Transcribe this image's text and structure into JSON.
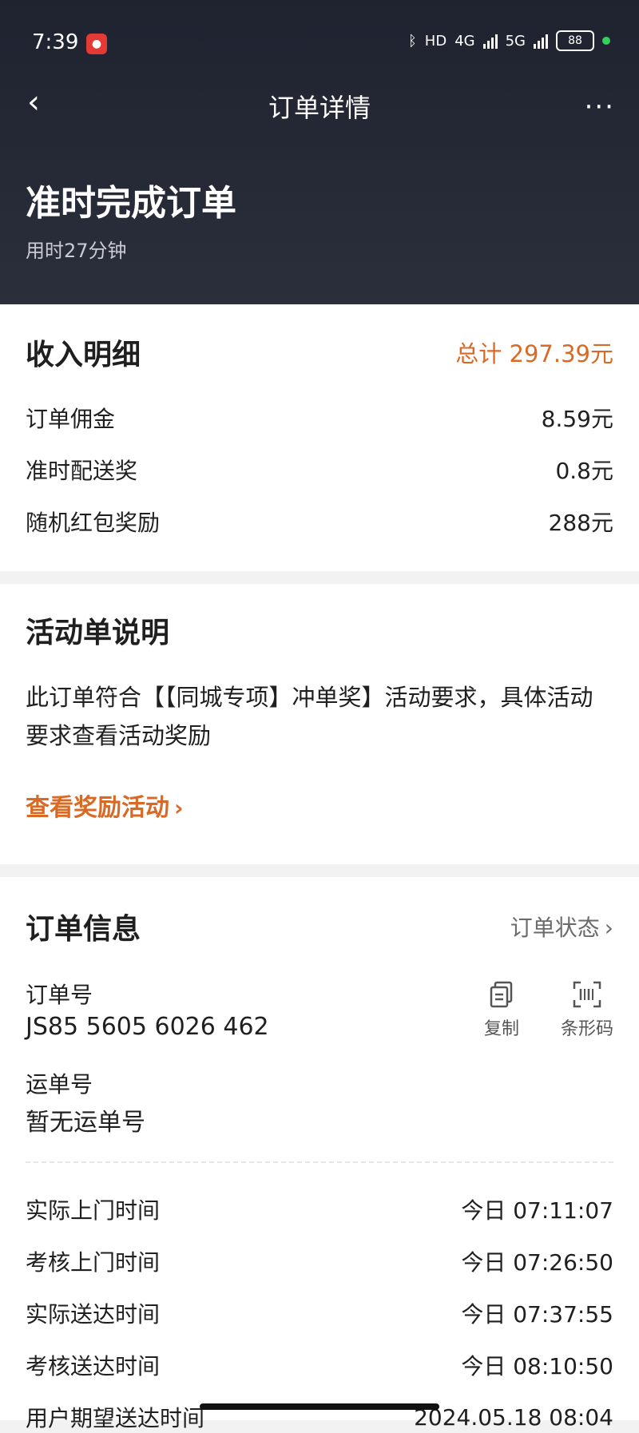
{
  "status_bar": {
    "time": "7:39",
    "hd_label": "HD",
    "net_4g": "4G",
    "net_5g": "5G",
    "battery": "88"
  },
  "nav": {
    "title": "订单详情",
    "back_glyph": "‹",
    "more_glyph": "···"
  },
  "order_header": {
    "title": "准时完成订单",
    "subtitle": "用时27分钟"
  },
  "income": {
    "title": "收入明细",
    "total": "总计 297.39元",
    "items": [
      {
        "label": "订单佣金",
        "value": "8.59元"
      },
      {
        "label": "准时配送奖",
        "value": "0.8元"
      },
      {
        "label": "随机红包奖励",
        "value": "288元"
      }
    ]
  },
  "activity": {
    "title": "活动单说明",
    "description": "此订单符合【【同城专项】冲单奖】活动要求，具体活动要求查看活动奖励",
    "link": "查看奖励活动"
  },
  "order_info": {
    "title": "订单信息",
    "status_link": "订单状态",
    "order_number_label": "订单号",
    "order_number": "JS85 5605 6026 462",
    "copy_label": "复制",
    "barcode_label": "条形码",
    "waybill_label": "运单号",
    "waybill_value": "暂无运单号",
    "times": [
      {
        "label": "实际上门时间",
        "value": "今日 07:11:07"
      },
      {
        "label": "考核上门时间",
        "value": "今日 07:26:50"
      },
      {
        "label": "实际送达时间",
        "value": "今日 07:37:55"
      },
      {
        "label": "考核送达时间",
        "value": "今日 08:10:50"
      },
      {
        "label": "用户期望送达时间",
        "value": "2024.05.18 08:04"
      }
    ]
  },
  "icons": {
    "back": "back-chevron-icon",
    "more": "more-dots-icon",
    "copy": "copy-icon",
    "barcode": "barcode-scan-icon",
    "link_chevron": "chevron-right-icon"
  }
}
